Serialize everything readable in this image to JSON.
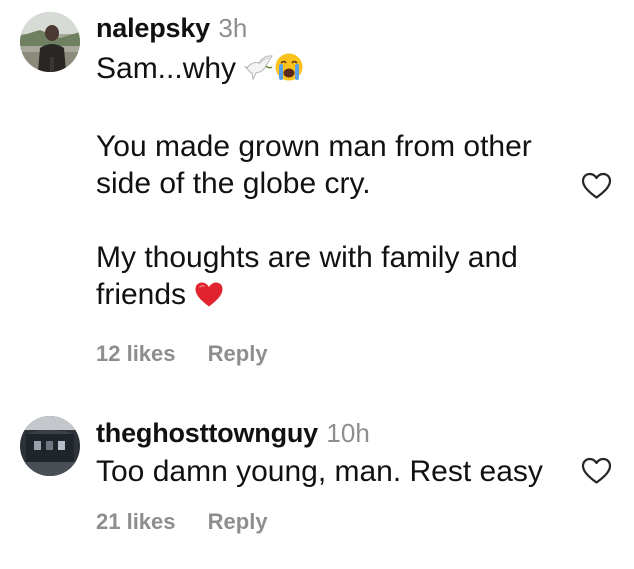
{
  "comments": [
    {
      "username": "nalepsky",
      "time": "3h",
      "line1": "Sam...why",
      "paragraph2": "You made grown man from other side of the globe cry.",
      "paragraph3": "My thoughts are with family and friends",
      "likes": "12 likes",
      "reply": "Reply",
      "icons": [
        "avatar",
        "dove-emoji",
        "crying-face-emoji",
        "red-heart-emoji",
        "heart-outline-icon"
      ]
    },
    {
      "username": "theghosttownguy",
      "time": "10h",
      "text": "Too damn young, man. Rest easy",
      "likes": "21 likes",
      "reply": "Reply",
      "icons": [
        "avatar",
        "heart-outline-icon"
      ]
    }
  ],
  "colors": {
    "text": "#111111",
    "muted": "#8e8e8e",
    "heart_emoji": "#e0232e"
  }
}
